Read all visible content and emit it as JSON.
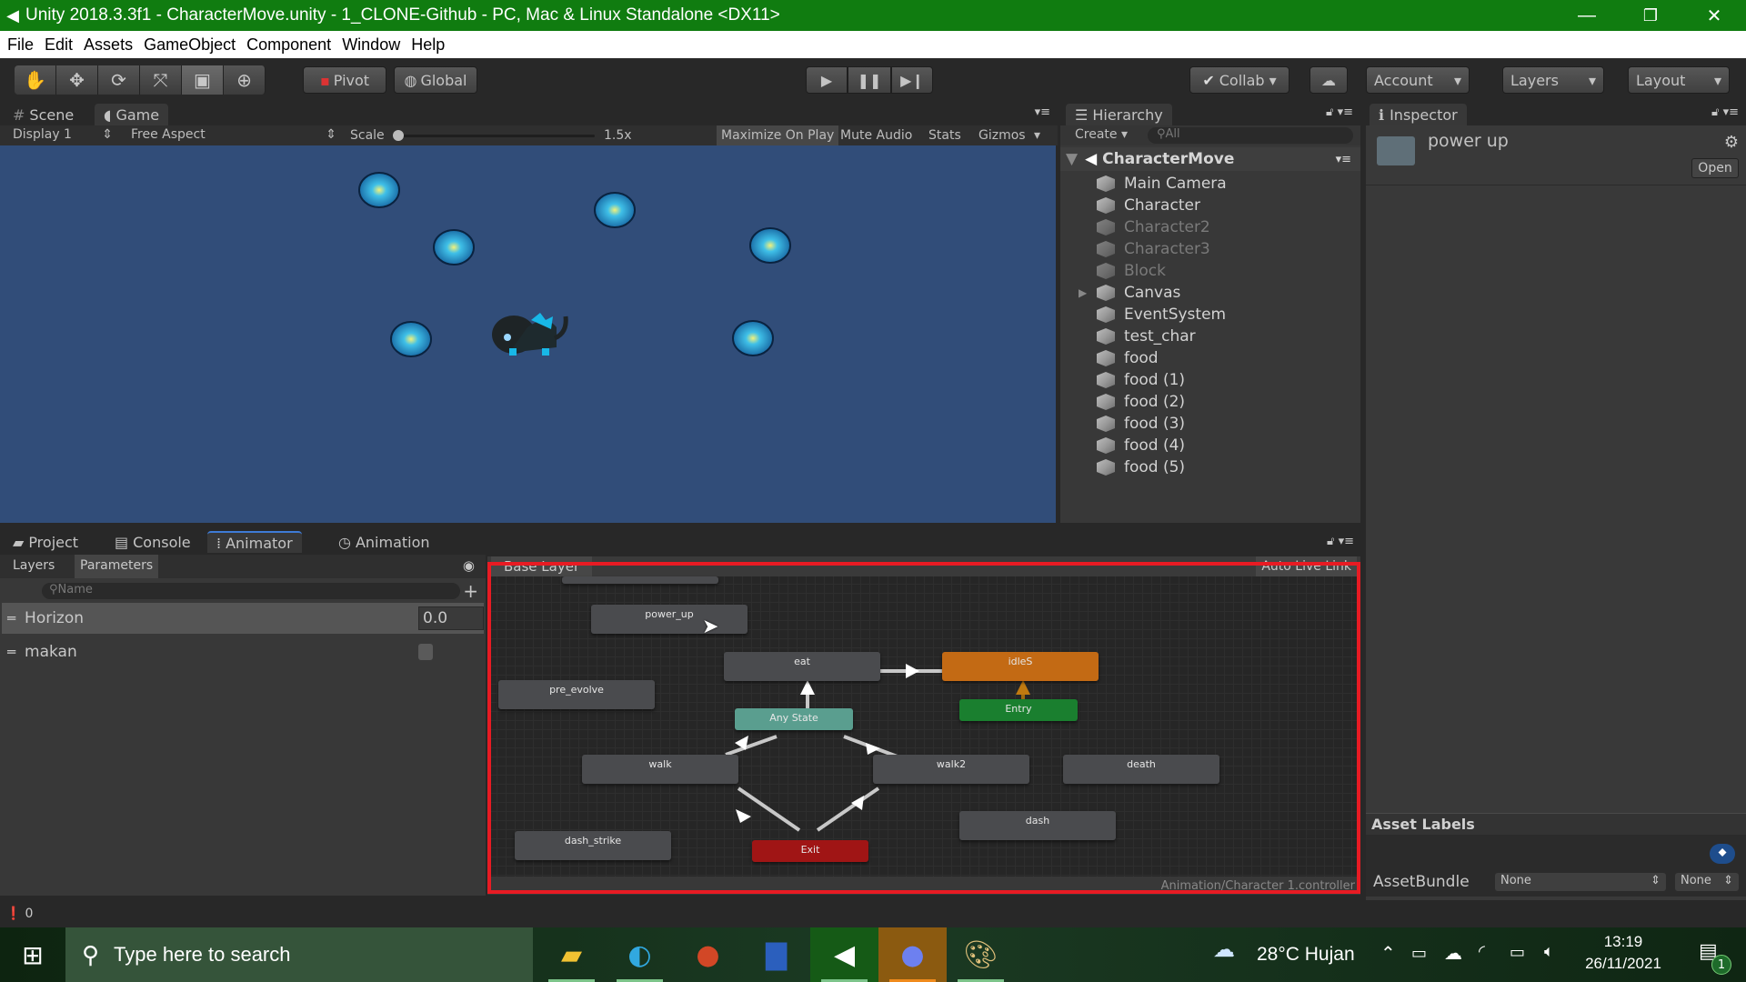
{
  "window": {
    "title": "Unity 2018.3.3f1 - CharacterMove.unity - 1_CLONE-Github - PC, Mac & Linux Standalone <DX11>",
    "minimize": "—",
    "restore": "❐",
    "close": "✕"
  },
  "menu": [
    "File",
    "Edit",
    "Assets",
    "GameObject",
    "Component",
    "Window",
    "Help"
  ],
  "toolbar": {
    "tools": [
      "hand-tool",
      "move-tool",
      "rotate-tool",
      "scale-tool",
      "rect-tool",
      "transform-tool"
    ],
    "pivot": "Pivot",
    "global": "Global",
    "play": "▶",
    "pause": "❚❚",
    "step": "▶❙",
    "collab": "Collab ▾",
    "account": "Account",
    "layers": "Layers",
    "layout": "Layout"
  },
  "game_view": {
    "tabs": [
      "Scene",
      "Game"
    ],
    "active_tab": "Game",
    "display": "Display 1",
    "aspect": "Free Aspect",
    "scale_label": "Scale",
    "scale_value": "1.5x",
    "scale_fraction": 0.0,
    "toggles": [
      "Maximize On Play",
      "Mute Audio",
      "Stats",
      "Gizmos"
    ],
    "background": "#314D79"
  },
  "hierarchy": {
    "tab": "Hierarchy",
    "create": "Create",
    "search_placeholder": "All",
    "scene": "CharacterMove",
    "items": [
      {
        "name": "Main Camera",
        "dim": false,
        "expandable": false
      },
      {
        "name": "Character",
        "dim": false,
        "expandable": false
      },
      {
        "name": "Character2",
        "dim": true,
        "expandable": false
      },
      {
        "name": "Character3",
        "dim": true,
        "expandable": false
      },
      {
        "name": "Block",
        "dim": true,
        "expandable": false
      },
      {
        "name": "Canvas",
        "dim": false,
        "expandable": true
      },
      {
        "name": "EventSystem",
        "dim": false,
        "expandable": false
      },
      {
        "name": "test_char",
        "dim": false,
        "expandable": false
      },
      {
        "name": "food",
        "dim": false,
        "expandable": false
      },
      {
        "name": "food (1)",
        "dim": false,
        "expandable": false
      },
      {
        "name": "food (2)",
        "dim": false,
        "expandable": false
      },
      {
        "name": "food (3)",
        "dim": false,
        "expandable": false
      },
      {
        "name": "food (4)",
        "dim": false,
        "expandable": false
      },
      {
        "name": "food (5)",
        "dim": false,
        "expandable": false
      }
    ]
  },
  "inspector": {
    "tab": "Inspector",
    "asset_name": "power up",
    "open_button": "Open",
    "asset_labels": "Asset Labels",
    "assetbundle_label": "AssetBundle",
    "assetbundle_value": "None",
    "assetbundle_variant": "None"
  },
  "bottom_tabs": [
    "Project",
    "Console",
    "Animator",
    "Animation"
  ],
  "active_bottom_tab": "Animator",
  "animator": {
    "side_tabs": [
      "Layers",
      "Parameters"
    ],
    "search_placeholder": "Name",
    "add": "+",
    "parameters": [
      {
        "name": "Horizon",
        "type": "float",
        "value": "0.0"
      },
      {
        "name": "makan",
        "type": "bool",
        "value": false
      }
    ],
    "layer": "Base Layer",
    "auto_live_link": "Auto Live Link",
    "controller_path": "Animation/Character 1.controller",
    "states": [
      "power_up",
      "eat",
      "idleS",
      "pre_evolve",
      "Any State",
      "Entry",
      "walk",
      "walk2",
      "death",
      "dash",
      "dash_strike",
      "Exit"
    ],
    "highlight_color": "#E81B23"
  },
  "status": {
    "count": "0"
  },
  "taskbar": {
    "search_placeholder": "Type here to search",
    "weather": "28°C  Hujan",
    "time": "13:19",
    "date": "26/11/2021",
    "notifications": "1",
    "apps": [
      "file-explorer",
      "edge",
      "powerpoint",
      "word",
      "unity",
      "discord",
      "paint"
    ]
  }
}
